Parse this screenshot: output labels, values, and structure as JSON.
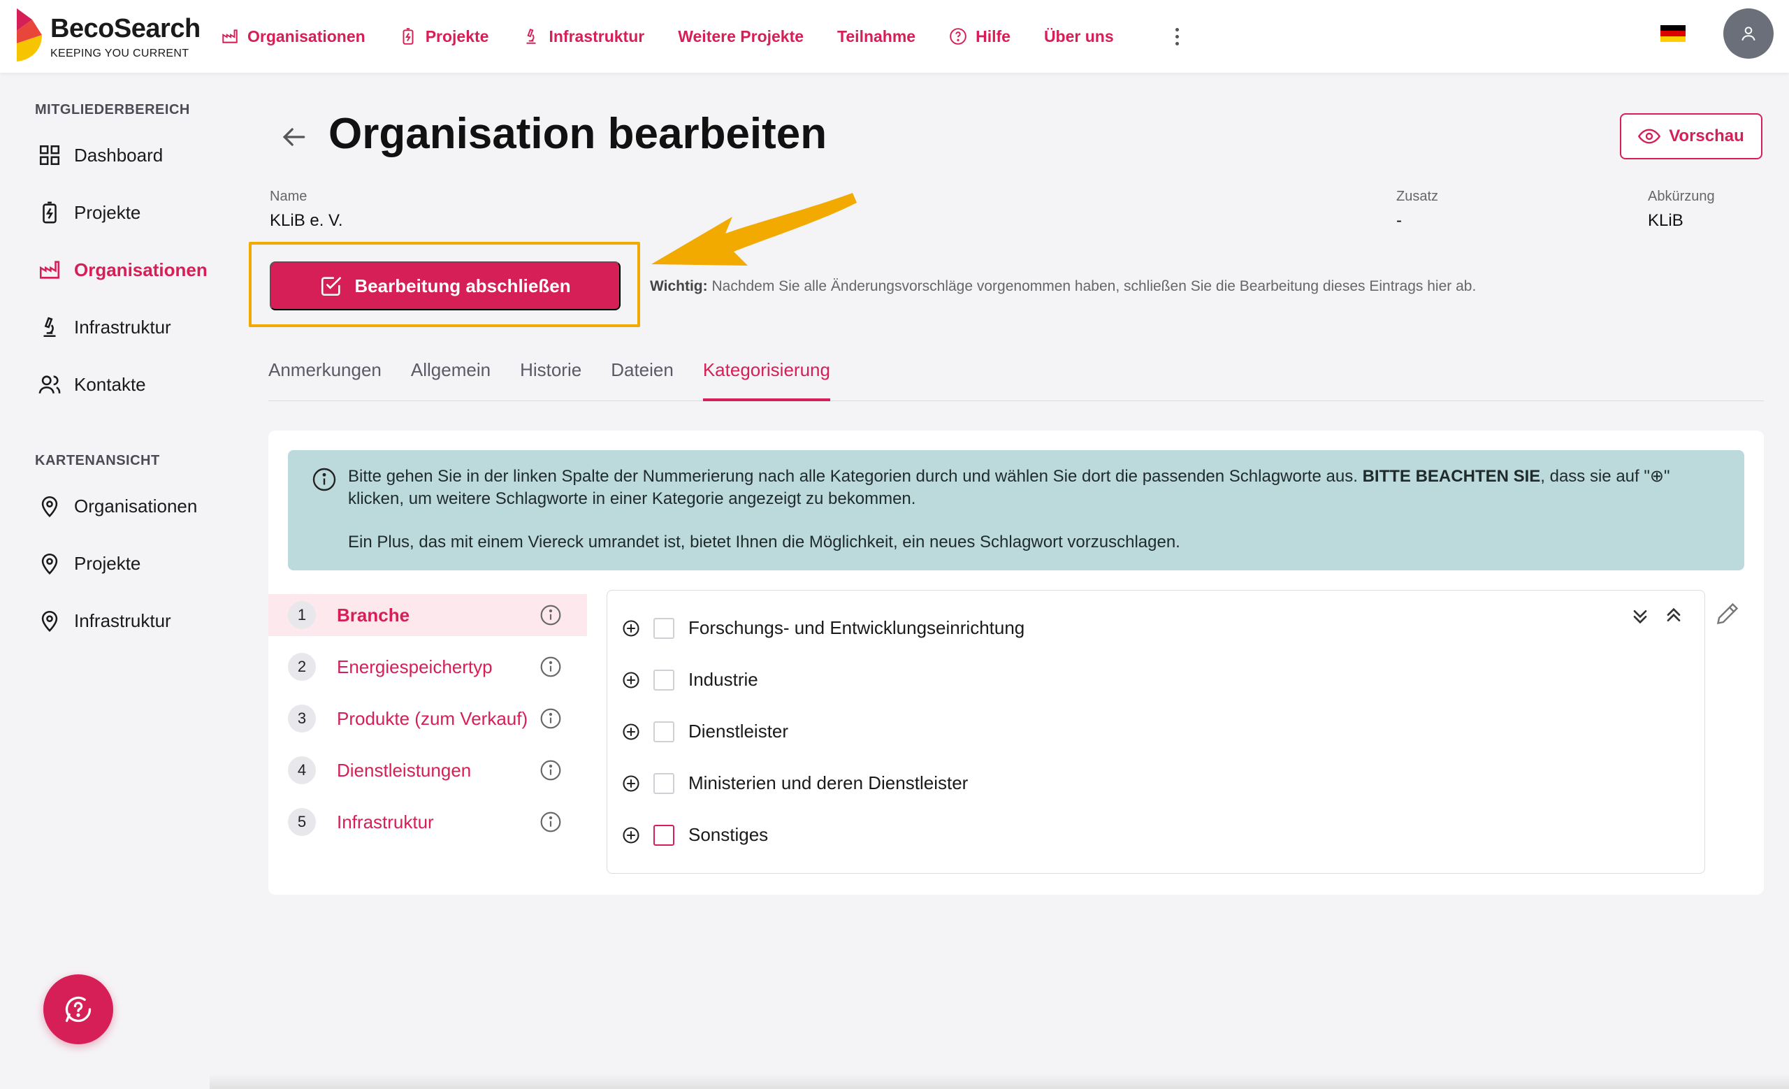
{
  "brand": {
    "name": "BecoSearch",
    "tagline": "KEEPING YOU CURRENT",
    "accent": "#d61f56"
  },
  "nav": {
    "items": [
      {
        "label": "Organisationen",
        "icon": "factory-icon"
      },
      {
        "label": "Projekte",
        "icon": "battery-icon"
      },
      {
        "label": "Infrastruktur",
        "icon": "microscope-icon"
      },
      {
        "label": "Weitere Projekte",
        "icon": ""
      },
      {
        "label": "Teilnahme",
        "icon": ""
      },
      {
        "label": "Hilfe",
        "icon": "help-circle-icon"
      },
      {
        "label": "Über uns",
        "icon": ""
      }
    ],
    "language_flag": "de-flag-icon"
  },
  "sidebar": {
    "member_heading": "MITGLIEDERBEREICH",
    "member_items": [
      {
        "label": "Dashboard",
        "icon": "grid-icon"
      },
      {
        "label": "Projekte",
        "icon": "battery-icon"
      },
      {
        "label": "Organisationen",
        "icon": "factory-icon",
        "active": true
      },
      {
        "label": "Infrastruktur",
        "icon": "microscope-icon"
      },
      {
        "label": "Kontakte",
        "icon": "users-icon"
      }
    ],
    "map_heading": "KARTENANSICHT",
    "map_items": [
      {
        "label": "Organisationen",
        "icon": "map-pin-icon"
      },
      {
        "label": "Projekte",
        "icon": "map-pin-icon"
      },
      {
        "label": "Infrastruktur",
        "icon": "map-pin-icon"
      }
    ]
  },
  "page": {
    "title": "Organisation bearbeiten",
    "preview_label": "Vorschau"
  },
  "meta": {
    "name_label": "Name",
    "name_value": "KLiB e. V.",
    "zusatz_label": "Zusatz",
    "zusatz_value": "-",
    "abk_label": "Abkürzung",
    "abk_value": "KLiB"
  },
  "finish": {
    "button_label": "Bearbeitung abschließen",
    "important_prefix": "Wichtig:",
    "important_text": " Nachdem Sie alle Änderungsvorschläge vorgenommen haben, schließen Sie die Bearbeitung dieses Eintrags hier ab."
  },
  "tabs": [
    {
      "label": "Anmerkungen"
    },
    {
      "label": "Allgemein"
    },
    {
      "label": "Historie"
    },
    {
      "label": "Dateien"
    },
    {
      "label": "Kategorisierung",
      "active": true
    }
  ],
  "info": {
    "line1_start": "Bitte gehen Sie in der linken Spalte der Nummerierung nach alle Kategorien durch und wählen Sie dort die passenden Schlagworte aus. ",
    "line1_bold": "BITTE BEACHTEN SIE",
    "line1_end": ", dass sie auf \"⊕\" klicken, um weitere Schlagworte in einer Kategorie angezeigt zu bekommen.",
    "line2": "Ein Plus, das mit einem Viereck umrandet ist, bietet Ihnen die Möglichkeit, ein neues Schlagwort vorzuschlagen."
  },
  "categories": [
    {
      "num": "1",
      "label": "Branche",
      "active": true
    },
    {
      "num": "2",
      "label": "Energiespeichertyp"
    },
    {
      "num": "3",
      "label": "Produkte (zum Verkauf)"
    },
    {
      "num": "4",
      "label": "Dienstleistungen"
    },
    {
      "num": "5",
      "label": "Infrastruktur"
    }
  ],
  "tags": [
    {
      "label": "Forschungs- und Entwicklungseinrichtung",
      "checked": false
    },
    {
      "label": "Industrie",
      "checked": false
    },
    {
      "label": "Dienstleister",
      "checked": false
    },
    {
      "label": "Ministerien und deren Dienstleister",
      "checked": false
    },
    {
      "label": "Sonstiges",
      "checked": false
    }
  ]
}
